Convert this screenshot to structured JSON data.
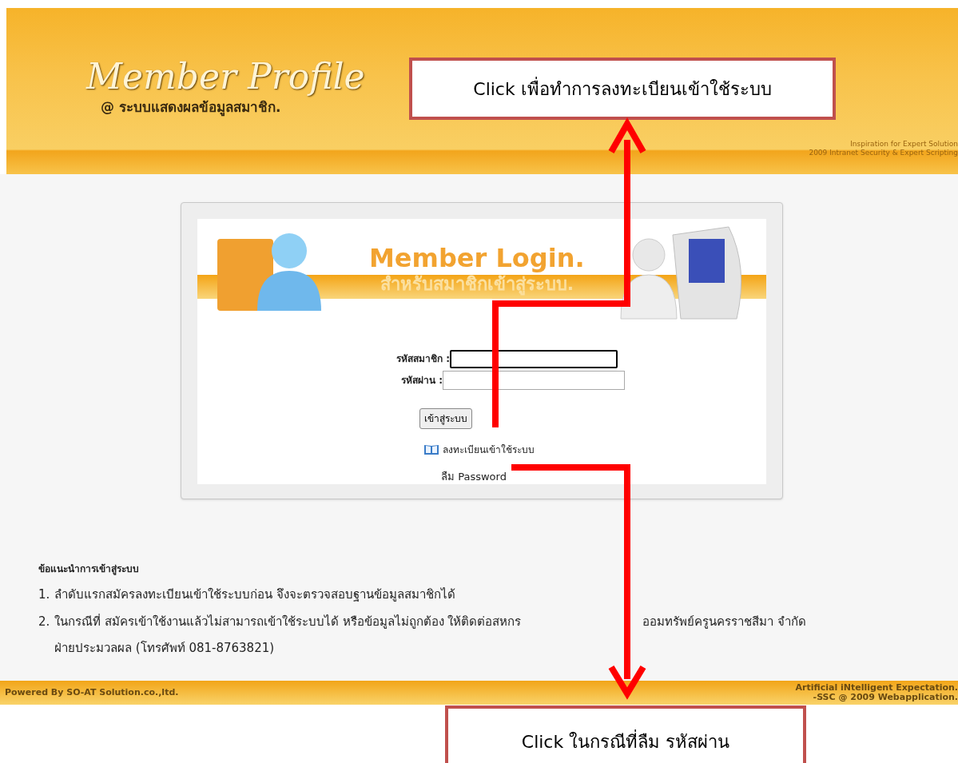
{
  "header": {
    "title": "Member Profile",
    "subtitle": "@ ระบบแสดงผลข้อมูลสมาชิก.",
    "tagline": [
      "Inspiration for Expert Solution",
      "2009 Intranet Security & Expert Scripting"
    ]
  },
  "login": {
    "banner_title": "Member Login.",
    "banner_subtitle": "สำหรับสมาชิกเข้าสู่ระบบ.",
    "fields": [
      {
        "label": "รหัสสมาชิก :",
        "focused": true
      },
      {
        "label": "รหัสผ่าน :",
        "focused": false
      }
    ],
    "button": "เข้าสู่ระบบ",
    "register_link": "ลงทะเบียนเข้าใช้ระบบ",
    "forgot_link": "ลืม Password"
  },
  "instructions": {
    "heading": "ข้อแนะนำการเข้าสู่ระบบ",
    "items": [
      {
        "number": "1.",
        "lines": [
          [
            "ลำดับแรกสมัครลงทะเบียนเข้าใช้ระบบก่อน จึงจะตรวจสอบฐานข้อมูลสมาชิกได้"
          ]
        ]
      },
      {
        "number": "2.",
        "lines": [
          [
            "ในกรณีที่ สมัครเข้าใช้งานแล้วไม่สามารถเข้าใช้ระบบได้ หรือข้อมูลไม่ถูกต้อง ให้ติดต่อสหกร",
            "ออมทรัพย์ครูนครราชสีมา จำกัด"
          ],
          [
            "ฝ่ายประมวลผล (โทรศัพท์ 081-8763821)"
          ]
        ]
      }
    ]
  },
  "footer": {
    "left": "Powered By SO-AT  Solution.co.,ltd.",
    "right": [
      "Artificial iNtelligent Expectation.",
      "-SSC @ 2009 Webapplication."
    ]
  },
  "callouts": [
    {
      "text": "Click เพื่อทำการลงทะเบียนเข้าใช้ระบบ"
    },
    {
      "text": "Click ในกรณีที่ลืม รหัสผ่าน"
    }
  ]
}
